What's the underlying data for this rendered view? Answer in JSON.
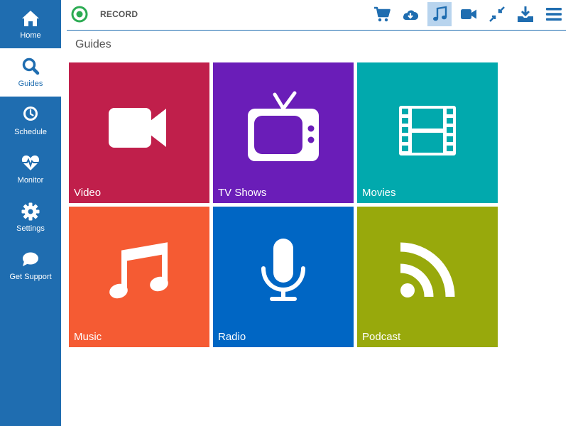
{
  "sidebar": {
    "items": [
      {
        "label": "Home",
        "icon": "home-icon",
        "active": false
      },
      {
        "label": "Guides",
        "icon": "search-icon",
        "active": true
      },
      {
        "label": "Schedule",
        "icon": "clock-icon",
        "active": false
      },
      {
        "label": "Monitor",
        "icon": "heartbeat-icon",
        "active": false
      },
      {
        "label": "Settings",
        "icon": "gear-icon",
        "active": false
      },
      {
        "label": "Get Support",
        "icon": "chat-bubble-icon",
        "active": false
      }
    ]
  },
  "header": {
    "title": "RECORD",
    "toolbar": [
      {
        "icon": "cart-icon",
        "active": false
      },
      {
        "icon": "cloud-download-icon",
        "active": false
      },
      {
        "icon": "music-note-icon",
        "active": true
      },
      {
        "icon": "video-camera-icon",
        "active": false
      },
      {
        "icon": "compress-icon",
        "active": false
      },
      {
        "icon": "download-tray-icon",
        "active": false
      },
      {
        "icon": "menu-icon",
        "active": false
      }
    ]
  },
  "main": {
    "title": "Guides",
    "tiles": [
      {
        "label": "Video",
        "icon": "video-camera-icon",
        "color": "#c01f4b"
      },
      {
        "label": "TV Shows",
        "icon": "tv-icon",
        "color": "#6a1db8"
      },
      {
        "label": "Movies",
        "icon": "film-strip-icon",
        "color": "#01a9ad"
      },
      {
        "label": "Music",
        "icon": "music-notes-icon",
        "color": "#f55b33"
      },
      {
        "label": "Radio",
        "icon": "microphone-icon",
        "color": "#0066c4"
      },
      {
        "label": "Podcast",
        "icon": "rss-icon",
        "color": "#98a90c"
      }
    ]
  },
  "colors": {
    "sidebar": "#1f6db0",
    "accent": "#1f6db0",
    "logo": "#2bab52"
  }
}
